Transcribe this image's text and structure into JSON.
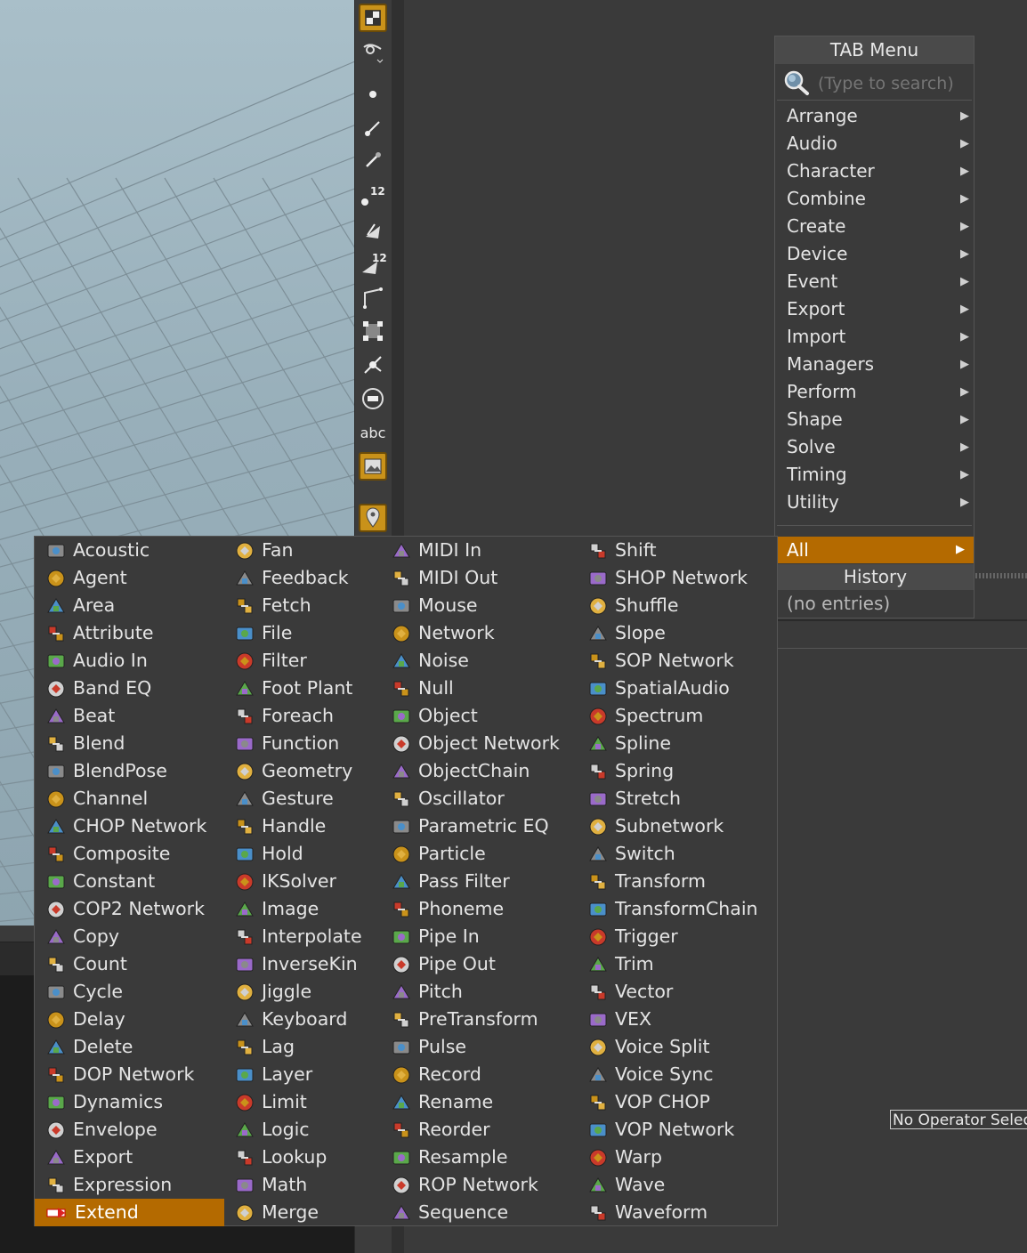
{
  "tab_menu": {
    "title": "TAB Menu",
    "search_placeholder": "(Type to search)",
    "categories": [
      "Arrange",
      "Audio",
      "Character",
      "Combine",
      "Create",
      "Device",
      "Event",
      "Export",
      "Import",
      "Managers",
      "Perform",
      "Shape",
      "Solve",
      "Timing",
      "Utility"
    ],
    "all_label": "All",
    "history_label": "History",
    "history_empty": "(no entries)"
  },
  "shelf": {
    "text_tool_label": "abc",
    "points_badge": "12"
  },
  "status": {
    "no_operator": "No Operator Selected"
  },
  "all_menu": {
    "columns": [
      [
        "Acoustic",
        "Agent",
        "Area",
        "Attribute",
        "Audio In",
        "Band EQ",
        "Beat",
        "Blend",
        "BlendPose",
        "Channel",
        "CHOP Network",
        "Composite",
        "Constant",
        "COP2 Network",
        "Copy",
        "Count",
        "Cycle",
        "Delay",
        "Delete",
        "DOP Network",
        "Dynamics",
        "Envelope",
        "Export",
        "Expression",
        "Extend"
      ],
      [
        "Fan",
        "Feedback",
        "Fetch",
        "File",
        "Filter",
        "Foot Plant",
        "Foreach",
        "Function",
        "Geometry",
        "Gesture",
        "Handle",
        "Hold",
        "IKSolver",
        "Image",
        "Interpolate",
        "InverseKin",
        "Jiggle",
        "Keyboard",
        "Lag",
        "Layer",
        "Limit",
        "Logic",
        "Lookup",
        "Math",
        "Merge"
      ],
      [
        "MIDI In",
        "MIDI Out",
        "Mouse",
        "Network",
        "Noise",
        "Null",
        "Object",
        "Object Network",
        "ObjectChain",
        "Oscillator",
        "Parametric EQ",
        "Particle",
        "Pass Filter",
        "Phoneme",
        "Pipe In",
        "Pipe Out",
        "Pitch",
        "PreTransform",
        "Pulse",
        "Record",
        "Rename",
        "Reorder",
        "Resample",
        "ROP Network",
        "Sequence"
      ],
      [
        "Shift",
        "SHOP Network",
        "Shuffle",
        "Slope",
        "SOP Network",
        "SpatialAudio",
        "Spectrum",
        "Spline",
        "Spring",
        "Stretch",
        "Subnetwork",
        "Switch",
        "Transform",
        "TransformChain",
        "Trigger",
        "Trim",
        "Vector",
        "VEX",
        "Voice Split",
        "Voice Sync",
        "VOP CHOP",
        "VOP Network",
        "Warp",
        "Wave",
        "Waveform"
      ]
    ],
    "selected": "Extend",
    "accent": "#b46a00"
  }
}
